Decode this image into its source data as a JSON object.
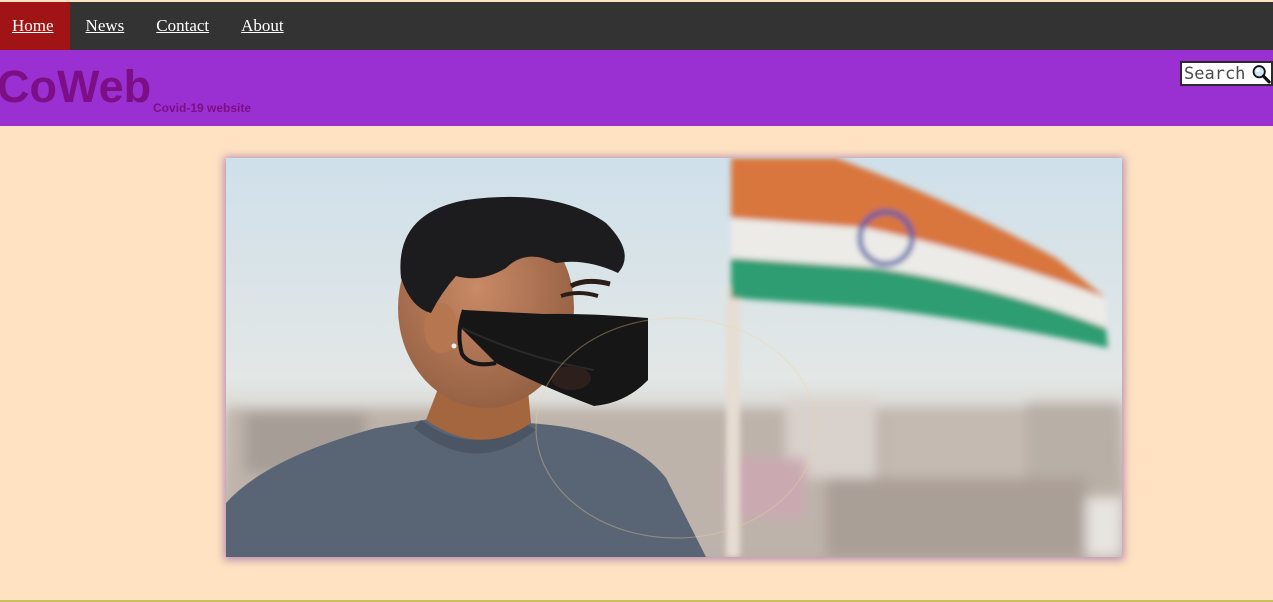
{
  "nav": {
    "items": [
      {
        "label": "Home",
        "active": true
      },
      {
        "label": "News",
        "active": false
      },
      {
        "label": "Contact",
        "active": false
      },
      {
        "label": "About",
        "active": false
      }
    ]
  },
  "header": {
    "brand": "CoWeb",
    "tagline": "Covid-19 website"
  },
  "search": {
    "placeholder": "Search",
    "icon": "magnifier-icon"
  },
  "hero": {
    "image": "masked-person-with-flag-photo"
  },
  "colors": {
    "nav_bg": "#333333",
    "nav_active": "#a01416",
    "header_bg": "#9a30d1",
    "brand_text": "#7d0f86",
    "page_bg": "#fee2c1"
  }
}
